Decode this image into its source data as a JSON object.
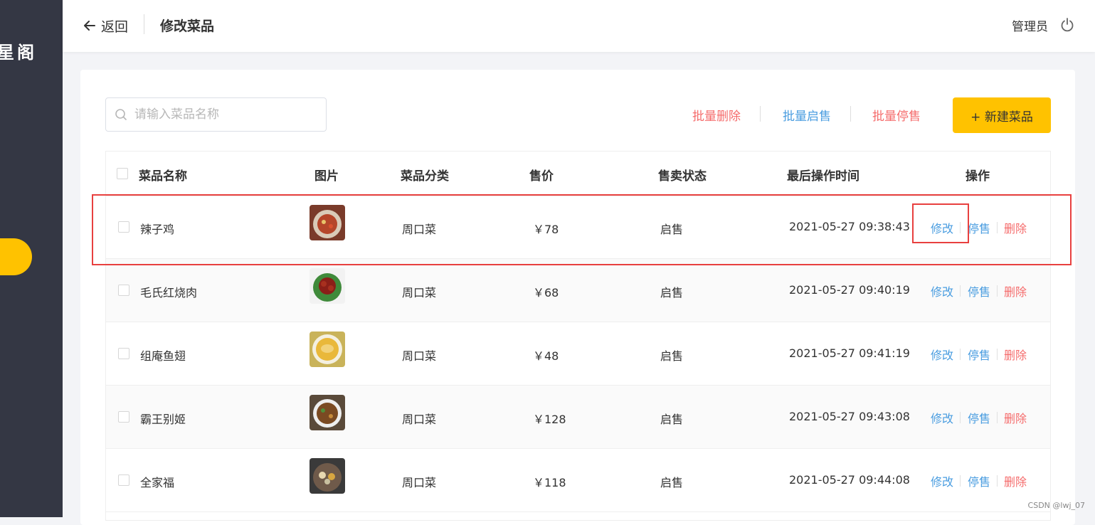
{
  "sidebar": {
    "brand_text": "星阁"
  },
  "header": {
    "back_label": "返回",
    "title": "修改菜品",
    "user": "管理员"
  },
  "toolbar": {
    "search_placeholder": "请输入菜品名称",
    "batch_delete": "批量删除",
    "batch_enable": "批量启售",
    "batch_disable": "批量停售",
    "new_button": "+ 新建菜品"
  },
  "table": {
    "columns": [
      "菜品名称",
      "图片",
      "菜品分类",
      "售价",
      "售卖状态",
      "最后操作时间",
      "操作"
    ],
    "actions": {
      "edit": "修改",
      "disable": "停售",
      "delete": "删除"
    },
    "rows": [
      {
        "name": "辣子鸡",
        "category": "周口菜",
        "price": "￥78",
        "status": "启售",
        "updated": "2021-05-27 09:38:43"
      },
      {
        "name": "毛氏红烧肉",
        "category": "周口菜",
        "price": "￥68",
        "status": "启售",
        "updated": "2021-05-27 09:40:19"
      },
      {
        "name": "组庵鱼翅",
        "category": "周口菜",
        "price": "￥48",
        "status": "启售",
        "updated": "2021-05-27 09:41:19"
      },
      {
        "name": "霸王别姬",
        "category": "周口菜",
        "price": "￥128",
        "status": "启售",
        "updated": "2021-05-27 09:43:08"
      },
      {
        "name": "全家福",
        "category": "周口菜",
        "price": "￥118",
        "status": "启售",
        "updated": "2021-05-27 09:44:08"
      }
    ]
  },
  "colors": {
    "accent": "#ffc200",
    "link_blue": "#4a9de0",
    "link_red": "#f56c6c",
    "sidebar_bg": "#343744",
    "highlight": "#e8403f"
  },
  "watermark": "CSDN @lwj_07"
}
